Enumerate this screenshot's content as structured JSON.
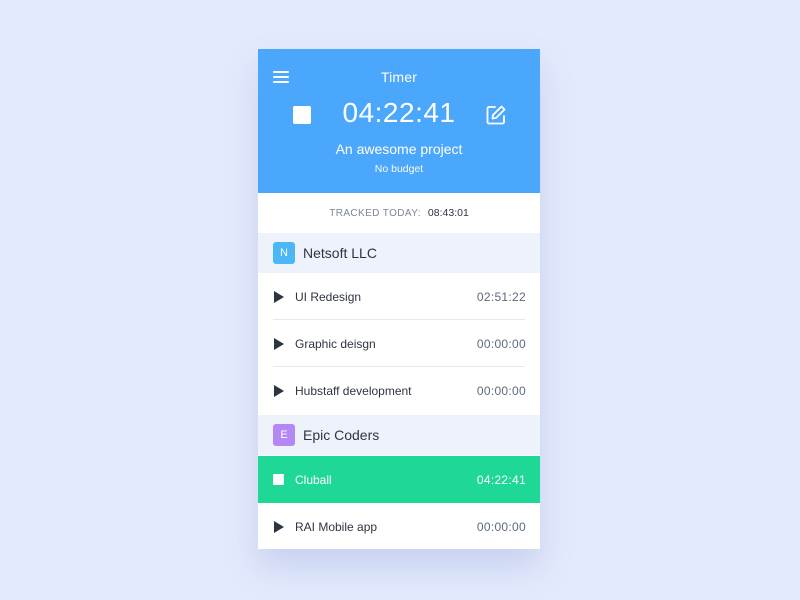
{
  "header": {
    "title": "Timer",
    "timer": "04:22:41",
    "project_name": "An awesome project",
    "budget": "No budget",
    "icons": {
      "menu": "hamburger-menu-icon",
      "stop": "stop-square-icon",
      "edit": "edit-pencil-icon"
    },
    "bg_color": "#4ba7fc"
  },
  "tracked": {
    "label": "TRACKED TODAY:",
    "value": "08:43:01"
  },
  "groups": [
    {
      "initial": "N",
      "name": "Netsoft LLC",
      "badge_color": "#4cb7f7",
      "tasks": [
        {
          "name": "UI Redesign",
          "time": "02:51:22",
          "active": false
        },
        {
          "name": "Graphic deisgn",
          "time": "00:00:00",
          "active": false
        },
        {
          "name": "Hubstaff development",
          "time": "00:00:00",
          "active": false
        }
      ]
    },
    {
      "initial": "E",
      "name": "Epic Coders",
      "badge_color": "#b487f7",
      "tasks": [
        {
          "name": "Cluball",
          "time": "04:22:41",
          "active": true
        },
        {
          "name": "RAI Mobile app",
          "time": "00:00:00",
          "active": false
        }
      ]
    }
  ],
  "colors": {
    "active_row": "#1fd895",
    "page_background": "#e3eafd"
  }
}
